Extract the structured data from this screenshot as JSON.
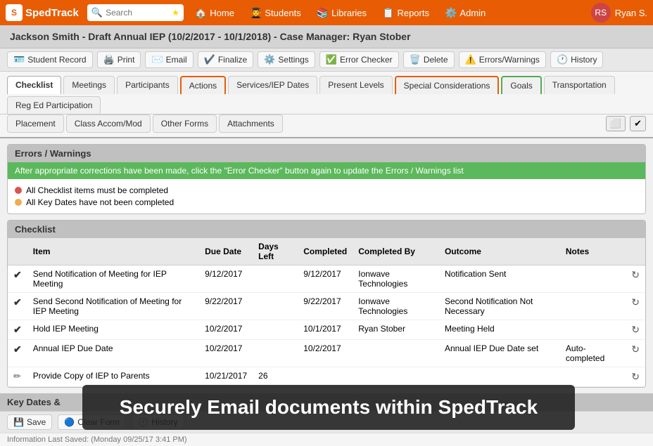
{
  "app": {
    "logo_text": "SpedTrack",
    "logo_letter": "S"
  },
  "nav": {
    "search_placeholder": "Search",
    "items": [
      {
        "label": "Home",
        "icon": "🏠"
      },
      {
        "label": "Students",
        "icon": "👨‍🎓"
      },
      {
        "label": "Libraries",
        "icon": "📚"
      },
      {
        "label": "Reports",
        "icon": "📋"
      },
      {
        "label": "Admin",
        "icon": "⚙️"
      }
    ],
    "user": "Ryan S."
  },
  "title_bar": {
    "text": "Jackson Smith - Draft Annual IEP (10/2/2017 - 10/1/2018) - Case Manager: Ryan Stober"
  },
  "toolbar": {
    "buttons": [
      {
        "label": "Student Record",
        "icon": "🪪"
      },
      {
        "label": "Print",
        "icon": "🖨️"
      },
      {
        "label": "Email",
        "icon": "✉️"
      },
      {
        "label": "Finalize",
        "icon": "✔️"
      },
      {
        "label": "Settings",
        "icon": "⚙️"
      },
      {
        "label": "Error Checker",
        "icon": "✅"
      },
      {
        "label": "Delete",
        "icon": "🗑️"
      },
      {
        "label": "Errors/Warnings",
        "icon": "⚠️"
      },
      {
        "label": "History",
        "icon": "🕐"
      }
    ]
  },
  "tabs_row1": [
    {
      "label": "Checklist",
      "active": true,
      "style": "active"
    },
    {
      "label": "Meetings",
      "style": "normal"
    },
    {
      "label": "Participants",
      "style": "normal"
    },
    {
      "label": "Actions",
      "style": "orange"
    },
    {
      "label": "Services/IEP Dates",
      "style": "normal"
    },
    {
      "label": "Present Levels",
      "style": "normal"
    },
    {
      "label": "Special Considerations",
      "style": "orange"
    },
    {
      "label": "Goals",
      "style": "green"
    },
    {
      "label": "Transportation",
      "style": "normal"
    },
    {
      "label": "Reg Ed Participation",
      "style": "normal"
    }
  ],
  "tabs_row2": [
    {
      "label": "Placement"
    },
    {
      "label": "Class Accom/Mod"
    },
    {
      "label": "Other Forms"
    },
    {
      "label": "Attachments"
    }
  ],
  "errors_section": {
    "header": "Errors / Warnings",
    "banner": "After appropriate corrections have been made, click the \"Error Checker\" button again to update the Errors / Warnings list",
    "items": [
      {
        "color": "red",
        "text": "All Checklist items must be completed"
      },
      {
        "color": "yellow",
        "text": "All Key Dates have not been completed"
      }
    ]
  },
  "checklist": {
    "header": "Checklist",
    "columns": [
      "Item",
      "Due Date",
      "Days Left",
      "Completed",
      "Completed By",
      "Outcome",
      "Notes"
    ],
    "rows": [
      {
        "status": "check",
        "item": "Send Notification of Meeting for IEP Meeting",
        "due_date": "9/12/2017",
        "days_left": "",
        "completed": "9/12/2017",
        "completed_by": "Ionwave Technologies",
        "outcome": "Notification Sent",
        "notes": ""
      },
      {
        "status": "check",
        "item": "Send Second Notification of Meeting for IEP Meeting",
        "due_date": "9/22/2017",
        "days_left": "",
        "completed": "9/22/2017",
        "completed_by": "Ionwave Technologies",
        "outcome": "Second Notification Not Necessary",
        "notes": ""
      },
      {
        "status": "check",
        "item": "Hold IEP Meeting",
        "due_date": "10/2/2017",
        "days_left": "",
        "completed": "10/1/2017",
        "completed_by": "Ryan Stober",
        "outcome": "Meeting Held",
        "notes": ""
      },
      {
        "status": "check",
        "item": "Annual IEP Due Date",
        "due_date": "10/2/2017",
        "days_left": "",
        "completed": "10/2/2017",
        "completed_by": "",
        "outcome": "Annual IEP Due Date set",
        "notes": "Auto-completed"
      },
      {
        "status": "pencil",
        "item": "Provide Copy of IEP to Parents",
        "due_date": "10/21/2017",
        "days_left": "26",
        "completed": "",
        "completed_by": "",
        "outcome": "",
        "notes": ""
      }
    ]
  },
  "key_dates_section": {
    "header": "Key Dates &"
  },
  "bottom_toolbar": {
    "save_label": "Save",
    "clear_label": "Clear Form",
    "history_label": "History"
  },
  "overlay": {
    "text": "Securely Email documents within SpedTrack"
  },
  "footer": {
    "text": "Information Last Saved: (Monday 09/25/17 3:41 PM)"
  }
}
